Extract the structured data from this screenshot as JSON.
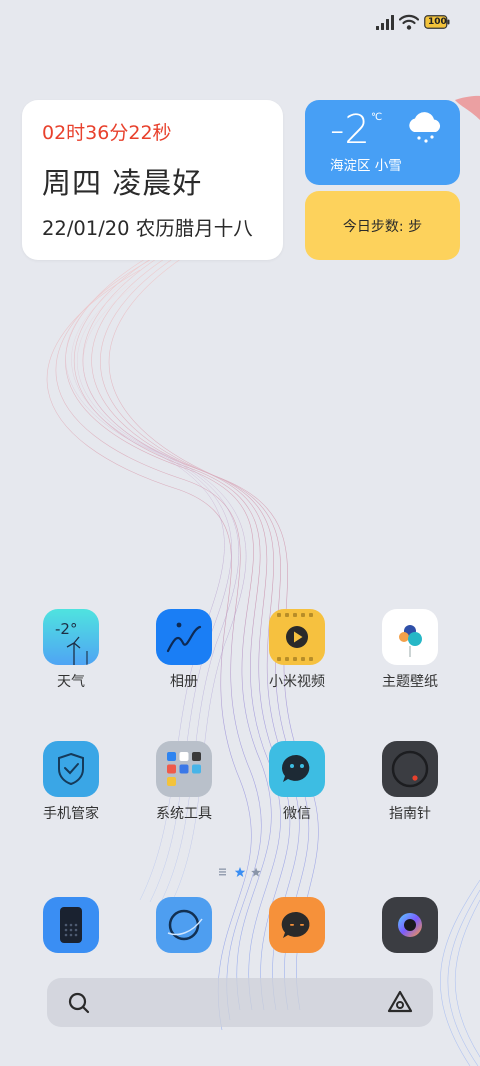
{
  "status_bar": {
    "battery": "100",
    "battery_color": "#f3c33b"
  },
  "clock_widget": {
    "time": "02时36分22秒",
    "greeting": "周四 凌晨好",
    "date": "22/01/20 农历腊月十八",
    "time_color": "#e8412d"
  },
  "weather_widget": {
    "temperature": "-2",
    "unit": "℃",
    "location_condition": "海淀区  小雪",
    "icon": "snow-cloud-icon",
    "bg_color": "#479ff5"
  },
  "steps_widget": {
    "label": "今日步数: 步",
    "bg_color": "#fdd25c"
  },
  "apps": {
    "weather": {
      "label": "天气",
      "icon": "weather-icon",
      "icon_text": "-2°"
    },
    "gallery": {
      "label": "相册",
      "icon": "gallery-icon"
    },
    "video": {
      "label": "小米视频",
      "icon": "video-icon"
    },
    "themes": {
      "label": "主题壁纸",
      "icon": "themes-icon"
    },
    "security": {
      "label": "手机管家",
      "icon": "security-icon"
    },
    "tools": {
      "label": "系统工具",
      "icon": "tools-folder-icon"
    },
    "wechat": {
      "label": "微信",
      "icon": "wechat-icon"
    },
    "compass": {
      "label": "指南针",
      "icon": "compass-icon"
    }
  },
  "dock": [
    "phone-icon",
    "browser-icon",
    "messages-icon",
    "camera-icon"
  ],
  "page_indicator": {
    "pages": 3,
    "current": 2
  },
  "search_bar": {
    "search_icon": "search-icon",
    "assistant_icon": "assistant-icon"
  }
}
